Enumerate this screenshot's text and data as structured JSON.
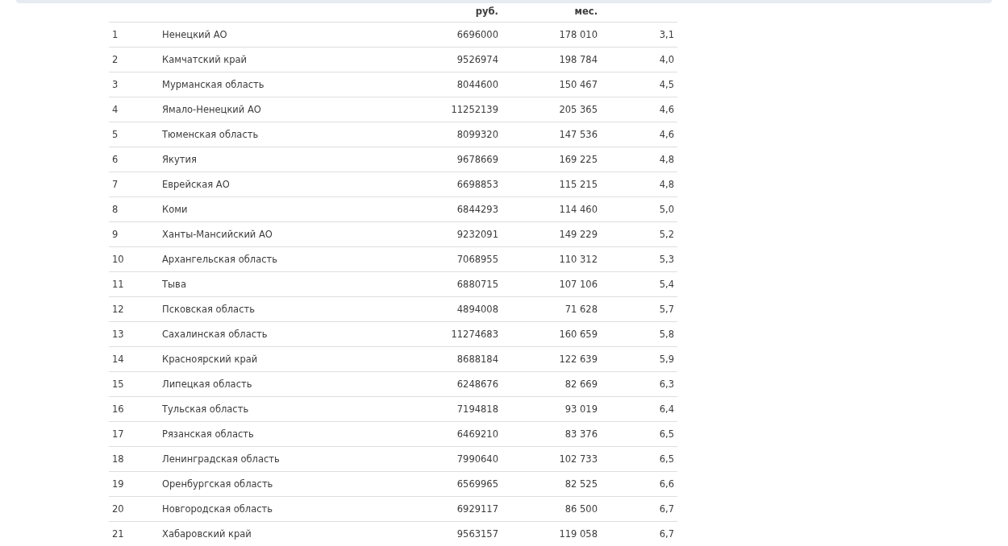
{
  "table": {
    "columns": [
      {},
      {},
      {
        "label": "руб."
      },
      {
        "label": "мес."
      },
      {}
    ],
    "rows": [
      [
        "1",
        "Ненецкий АО",
        "6696000",
        "178 010",
        "3,1"
      ],
      [
        "2",
        "Камчатский край",
        "9526974",
        "198 784",
        "4,0"
      ],
      [
        "3",
        "Мурманская область",
        "8044600",
        "150 467",
        "4,5"
      ],
      [
        "4",
        "Ямало-Ненецкий АО",
        "11252139",
        "205 365",
        "4,6"
      ],
      [
        "5",
        "Тюменская область",
        "8099320",
        "147 536",
        "4,6"
      ],
      [
        "6",
        "Якутия",
        "9678669",
        "169 225",
        "4,8"
      ],
      [
        "7",
        "Еврейская АО",
        "6698853",
        "115 215",
        "4,8"
      ],
      [
        "8",
        "Коми",
        "6844293",
        "114 460",
        "5,0"
      ],
      [
        "9",
        "Ханты-Мансийский АО",
        "9232091",
        "149 229",
        "5,2"
      ],
      [
        "10",
        "Архангельская область",
        "7068955",
        "110 312",
        "5,3"
      ],
      [
        "11",
        "Тыва",
        "6880715",
        "107 106",
        "5,4"
      ],
      [
        "12",
        "Псковская область",
        "4894008",
        "71 628",
        "5,7"
      ],
      [
        "13",
        "Сахалинская область",
        "11274683",
        "160 659",
        "5,8"
      ],
      [
        "14",
        "Красноярский край",
        "8688184",
        "122 639",
        "5,9"
      ],
      [
        "15",
        "Липецкая область",
        "6248676",
        "82 669",
        "6,3"
      ],
      [
        "16",
        "Тульская область",
        "7194818",
        "93 019",
        "6,4"
      ],
      [
        "17",
        "Рязанская область",
        "6469210",
        "83 376",
        "6,5"
      ],
      [
        "18",
        "Ленинградская область",
        "7990640",
        "102 733",
        "6,5"
      ],
      [
        "19",
        "Оренбургская область",
        "6569965",
        "82 525",
        "6,6"
      ],
      [
        "20",
        "Новгородская область",
        "6929117",
        "86 500",
        "6,7"
      ],
      [
        "21",
        "Хабаровский край",
        "9563157",
        "119 058",
        "6,7"
      ]
    ]
  }
}
